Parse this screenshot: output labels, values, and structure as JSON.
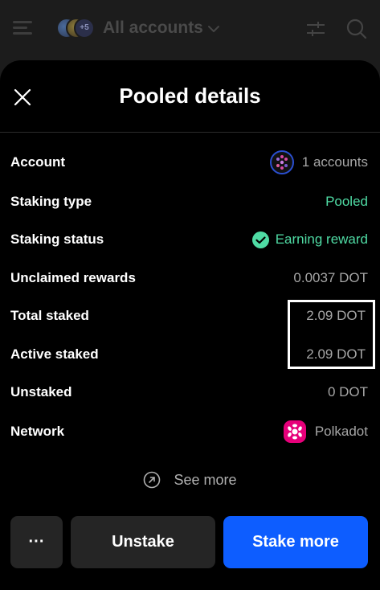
{
  "header": {
    "title": "All accounts",
    "avatar_badge": "+5",
    "icons": [
      "menu-icon",
      "chevron-down-icon",
      "filter-icon",
      "search-icon"
    ]
  },
  "modal": {
    "title": "Pooled details",
    "close_icon": "close-icon"
  },
  "details": {
    "account": {
      "label": "Account",
      "value": "1 accounts"
    },
    "staking_type": {
      "label": "Staking type",
      "value": "Pooled"
    },
    "staking_status": {
      "label": "Staking status",
      "value": "Earning reward"
    },
    "unclaimed_rewards": {
      "label": "Unclaimed rewards",
      "value": "0.0037 DOT"
    },
    "total_staked": {
      "label": "Total staked",
      "value": "2.09 DOT"
    },
    "active_staked": {
      "label": "Active staked",
      "value": "2.09 DOT"
    },
    "unstaked": {
      "label": "Unstaked",
      "value": "0 DOT"
    },
    "network": {
      "label": "Network",
      "value": "Polkadot"
    }
  },
  "see_more": "See more",
  "actions": {
    "more": "···",
    "unstake": "Unstake",
    "stake_more": "Stake more"
  },
  "colors": {
    "accent_blue": "#0d5dff",
    "green": "#4fdba4",
    "polkadot_pink": "#e6007a"
  }
}
